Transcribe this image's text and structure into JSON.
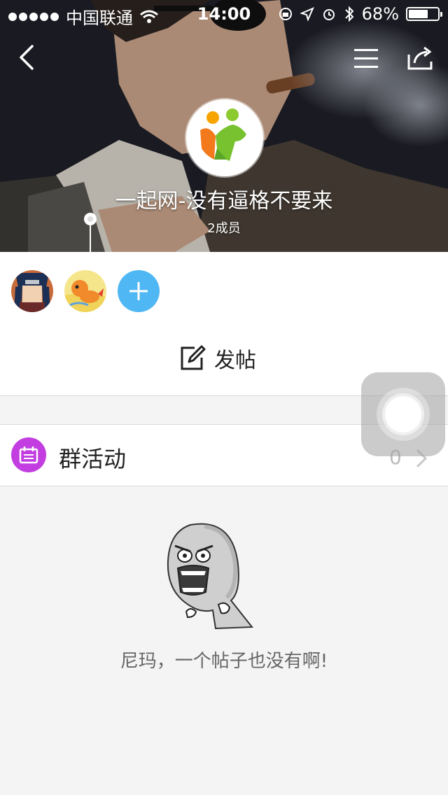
{
  "status_bar": {
    "carrier": "中国联通",
    "time": "14:00",
    "battery_percent": "68%",
    "battery_level": 0.68
  },
  "nav": {
    "back_icon": "chevron-left-icon",
    "menu_icon": "list-menu-icon",
    "share_icon": "share-icon"
  },
  "group": {
    "title": "一起网-没有逼格不要来",
    "members_text": "2成员"
  },
  "members": {
    "avatars": [
      "naruto-avatar",
      "pokemon-avatar"
    ],
    "add_icon": "plus-icon"
  },
  "post": {
    "label": "发帖",
    "icon": "edit-icon"
  },
  "activity": {
    "label": "群活动",
    "count": "0",
    "icon": "calendar-icon"
  },
  "empty_state": {
    "text": "尼玛，一个帖子也没有啊!",
    "image": "rage-face-illustration"
  },
  "colors": {
    "add_button": "#4fb7f3",
    "activity_icon": "#c23ee0"
  }
}
